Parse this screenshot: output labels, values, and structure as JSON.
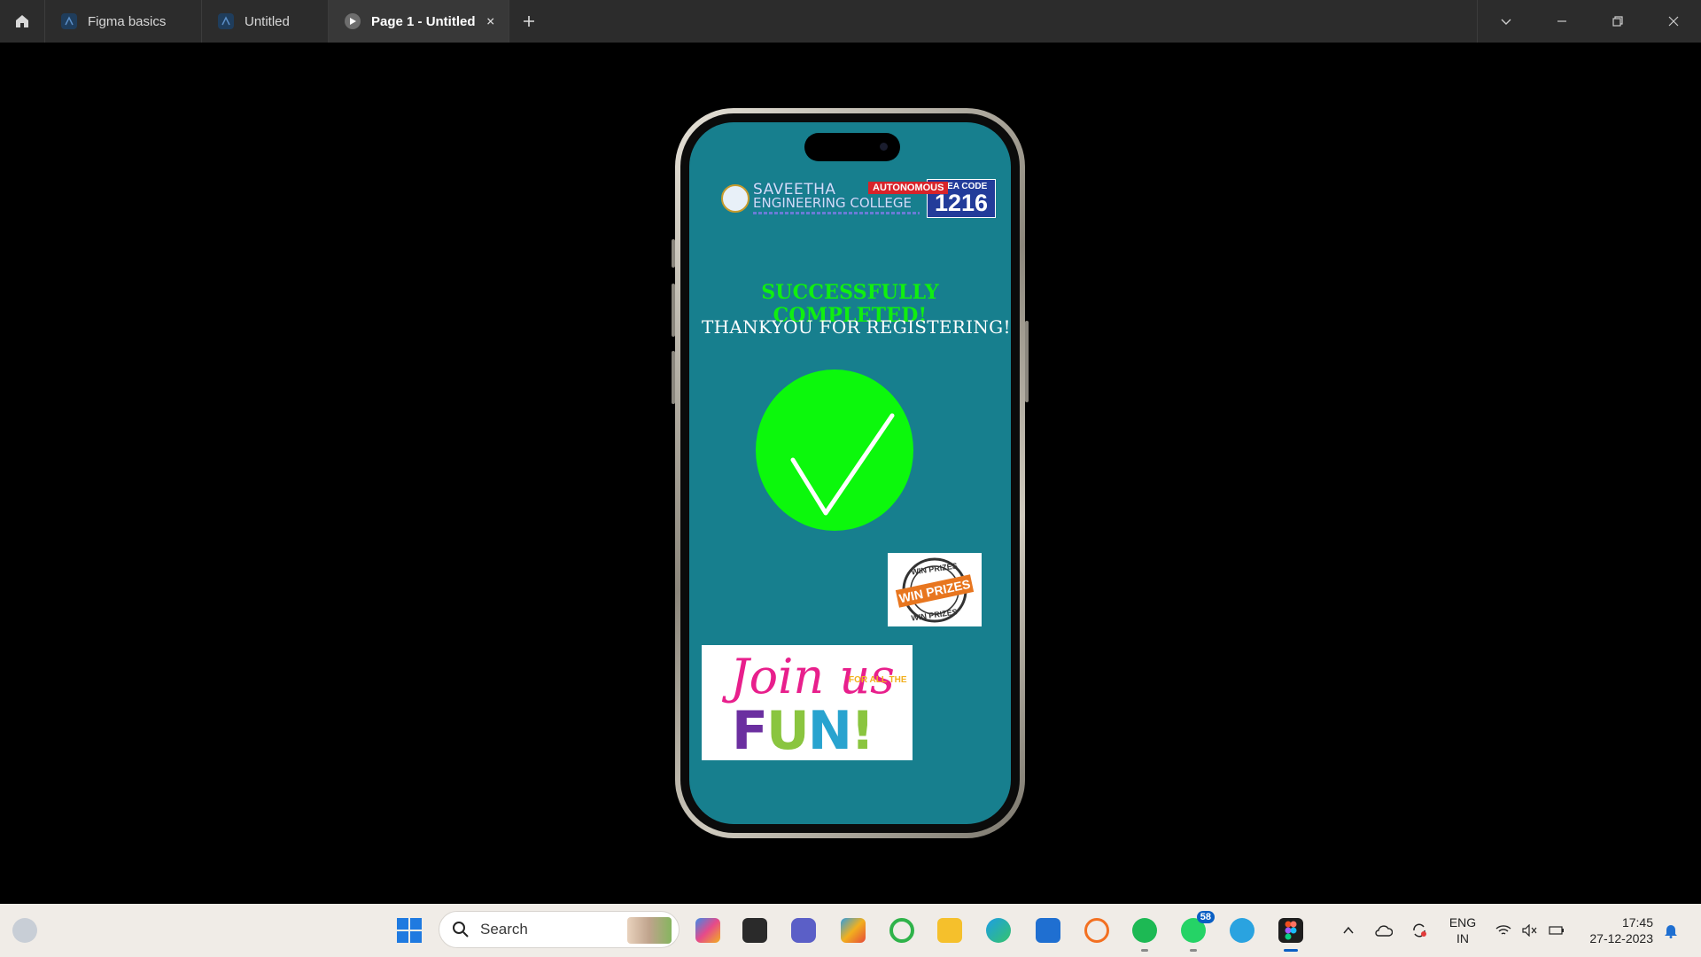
{
  "tabs": [
    {
      "label": "Figma basics"
    },
    {
      "label": "Untitled"
    },
    {
      "label": "Page 1 - Untitled"
    }
  ],
  "screen": {
    "logo": {
      "name_line1": "SAVEETHA",
      "name_line2": "ENGINEERING COLLEGE",
      "badge": "AUTONOMOUS",
      "code_label": "TNEA CODE",
      "code": "1216"
    },
    "success_text": "SUCCESSFULLY COMPLETED!",
    "thanks_text": "THANKYOU FOR REGISTERING!",
    "win_prizes": "WIN PRIZES",
    "join": {
      "line1": "Join us",
      "for_all": "FOR ALL THE",
      "fun": "FUN!"
    }
  },
  "taskbar": {
    "search_placeholder": "Search",
    "whatsapp_badge": "58",
    "lang_line1": "ENG",
    "lang_line2": "IN",
    "time": "17:45",
    "date": "27-12-2023"
  },
  "colors": {
    "screen_bg": "#177f8e",
    "success_green": "#10ef10",
    "check_green": "#0cf80c",
    "tab_bar": "#2c2c2c",
    "taskbar": "#f0ece7"
  }
}
